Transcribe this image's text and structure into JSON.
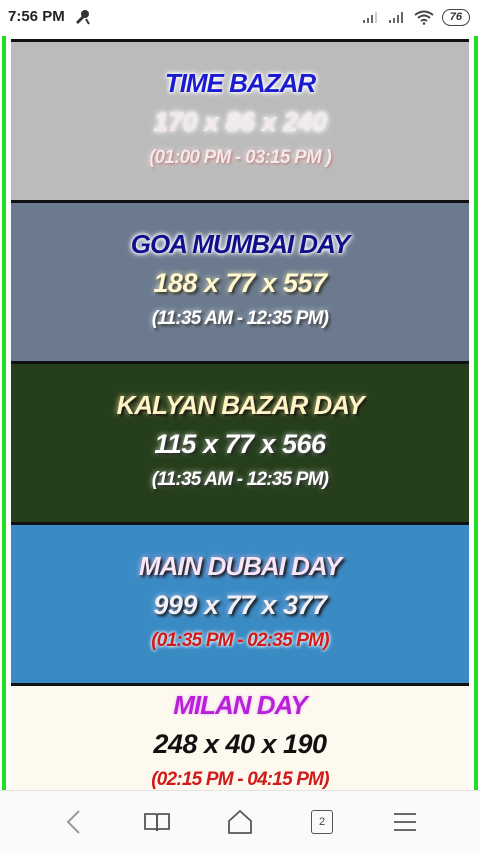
{
  "status": {
    "time": "7:56 PM",
    "battery": "76"
  },
  "cards": [
    {
      "title": "TIME BAZAR",
      "numbers": "170 x 86 x 240",
      "hours": "(01:00 PM - 03:15 PM )"
    },
    {
      "title": "GOA MUMBAI DAY",
      "numbers": "188 x 77 x 557",
      "hours": "(11:35 AM - 12:35 PM)"
    },
    {
      "title": "KALYAN BAZAR DAY",
      "numbers": "115 x 77 x 566",
      "hours": "(11:35 AM - 12:35 PM)"
    },
    {
      "title": "MAIN DUBAI DAY",
      "numbers": "999 x 77 x 377",
      "hours": "(01:35 PM - 02:35 PM)"
    },
    {
      "title": "MILAN DAY",
      "numbers": "248 x 40 x 190",
      "hours": "(02:15 PM - 04:15 PM)"
    }
  ],
  "colors": {
    "time_bazar_bg": "#bbbbbb",
    "goa_mumbai_bg": "#6b7a8f",
    "kalyan_bg": "#253e1b",
    "dubai_bg": "#3a8ac4",
    "milan_bg": "#fdf9ee",
    "side_border": "#22dd22"
  },
  "navbar": {
    "tabs_count": "2",
    "icons": [
      "back-icon",
      "bookmarks-icon",
      "home-icon",
      "tabs-icon",
      "menu-icon"
    ]
  }
}
